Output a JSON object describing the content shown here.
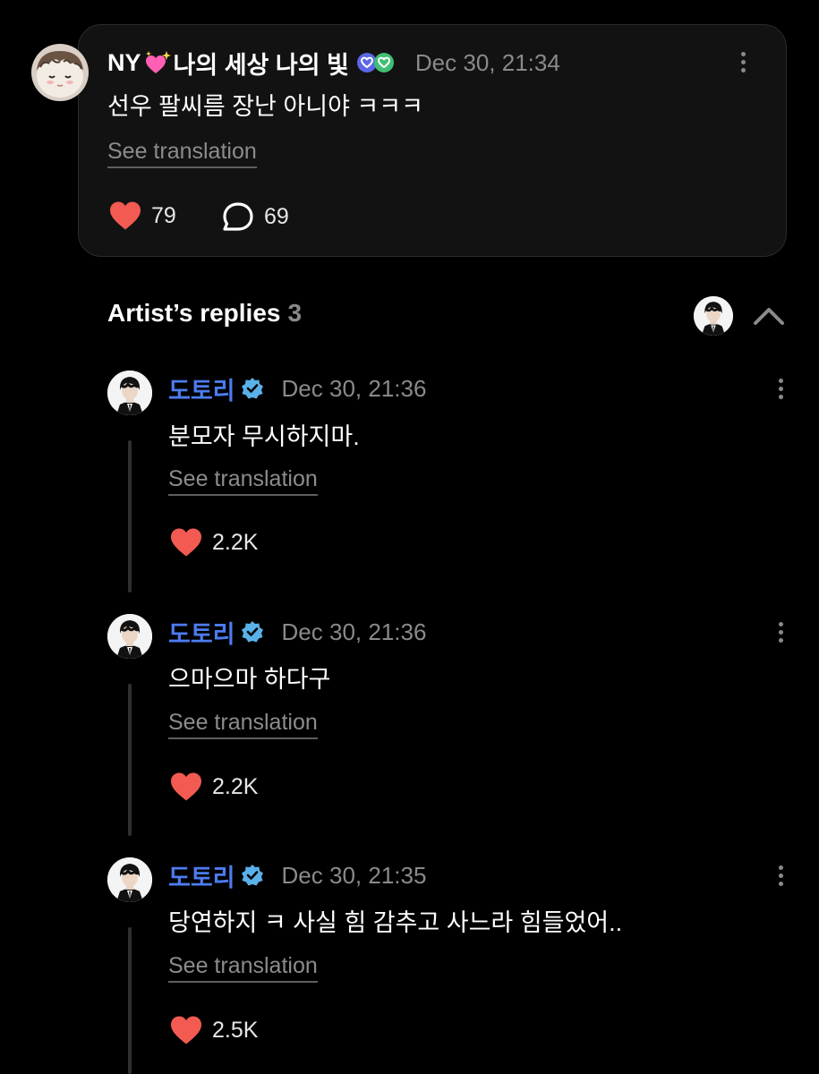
{
  "post": {
    "author_name": "NY",
    "author_name_suffix": "나의 세상 나의 빛",
    "timestamp": "Dec 30, 21:34",
    "text": "선우 팔씨름 장난 아니야 ㅋㅋㅋ",
    "see_translation": "See translation",
    "likes": "79",
    "comments": "69",
    "icons": {
      "avatar": "plush-doll-avatar",
      "sparkle": "sparkling-heart-emoji",
      "badges": "membership-heart-badges",
      "like": "heart-icon",
      "comment": "comment-bubble-icon",
      "more": "kebab-menu-icon"
    }
  },
  "replies_section": {
    "title": "Artist’s replies",
    "count": "3"
  },
  "replies": [
    {
      "author": "도토리",
      "timestamp": "Dec 30, 21:36",
      "text": "분모자 무시하지마.",
      "see_translation": "See translation",
      "likes": "2.2K"
    },
    {
      "author": "도토리",
      "timestamp": "Dec 30, 21:36",
      "text": "으마으마 하다구",
      "see_translation": "See translation",
      "likes": "2.2K"
    },
    {
      "author": "도토리",
      "timestamp": "Dec 30, 21:35",
      "text": "당연하지 ㅋ 사실 힘 감추고 사느라 힘들었어..",
      "see_translation": "See translation",
      "likes": "2.5K"
    }
  ],
  "colors": {
    "background": "#000000",
    "card": "#121212",
    "artist_name": "#4d7cf0",
    "verified": "#5ab0e8",
    "heart": "#f25a52",
    "muted_text": "#8a8a8a"
  }
}
